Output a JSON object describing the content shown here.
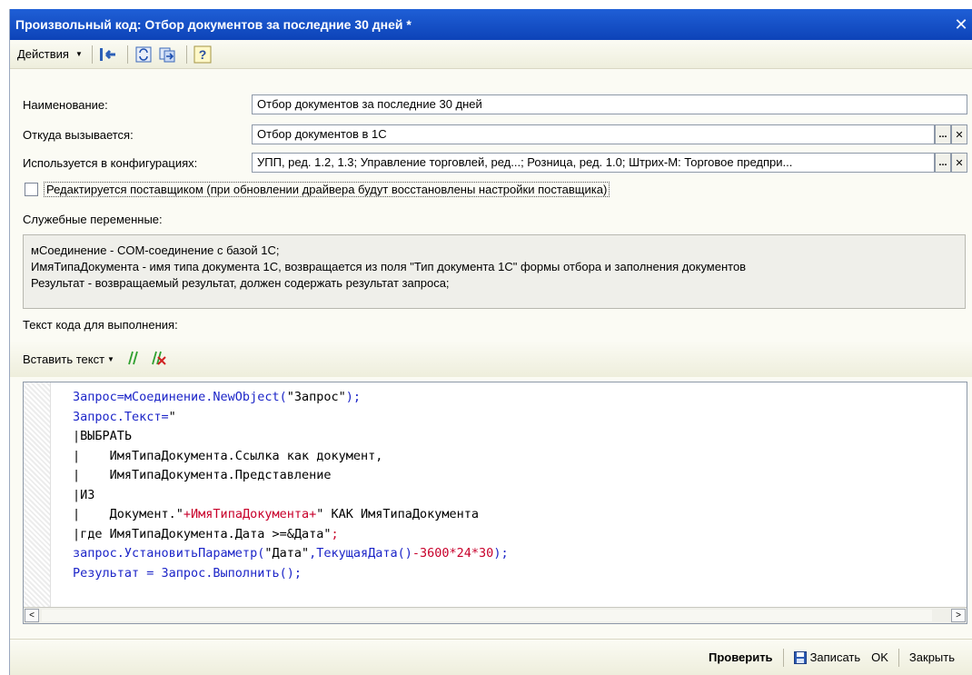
{
  "window": {
    "title": "Произвольный код: Отбор документов за последние 30 дней *",
    "close_glyph": "✕"
  },
  "toolbar": {
    "actions_label": "Действия",
    "help_glyph": "?"
  },
  "form": {
    "name_label": "Наименование:",
    "name_value": "Отбор документов за последние 30 дней",
    "called_from_label": "Откуда вызывается:",
    "called_from_value": "Отбор документов в 1С",
    "configs_label": "Используется в конфигурациях:",
    "configs_value": "УПП, ред. 1.2, 1.3; Управление торговлей, ред...; Розница, ред. 1.0; Штрих-М: Торговое предпри...",
    "ellipsis_glyph": "...",
    "clear_glyph": "✕",
    "vendor_checkbox_label": "Редактируется поставщиком (при обновлении драйвера будут восстановлены настройки поставщика)",
    "vendor_checked": false
  },
  "service_vars": {
    "label": "Служебные переменные:",
    "lines": [
      "мСоединение - COM-соединение с базой 1С;",
      "ИмяТипаДокумента - имя типа документа 1С, возвращается из поля \"Тип документа 1С\" формы отбора и заполнения документов",
      "Результат - возвращаемый результат, должен содержать результат запроса;"
    ]
  },
  "code_section": {
    "label": "Текст кода для выполнения:",
    "insert_text_label": "Вставить текст"
  },
  "code": {
    "line1_a": "Запрос=мСоединение.NewObject(",
    "line1_b": "\"Запрос\"",
    "line1_c": ");",
    "line2_a": "Запрос.Текст=",
    "line2_b": "\"",
    "line3": "|ВЫБРАТЬ",
    "line4": "|    ИмяТипаДокумента.Ссылка как документ,",
    "line5": "|    ИмяТипаДокумента.Представление",
    "line6": "|ИЗ",
    "line7_a": "|    Документ.\"",
    "line7_b": "+ИмяТипаДокумента+",
    "line7_c": "\" КАК ИмяТипаДокумента",
    "line8_a": "|где ИмяТипаДокумента.Дата >=&Дата\"",
    "line8_b": ";",
    "line9_a": "запрос.УстановитьПараметр(",
    "line9_b": "\"Дата\"",
    "line9_c": ",ТекущаяДата()",
    "line9_d": "-3600*24*30",
    "line9_e": ");",
    "line10_a": "Результат = Запрос.Выполнить();"
  },
  "scroll": {
    "left_glyph": "<",
    "right_glyph": ">"
  },
  "footer": {
    "check_label": "Проверить",
    "save_label": "Записать",
    "ok_label": "OK",
    "close_label": "Закрыть"
  }
}
